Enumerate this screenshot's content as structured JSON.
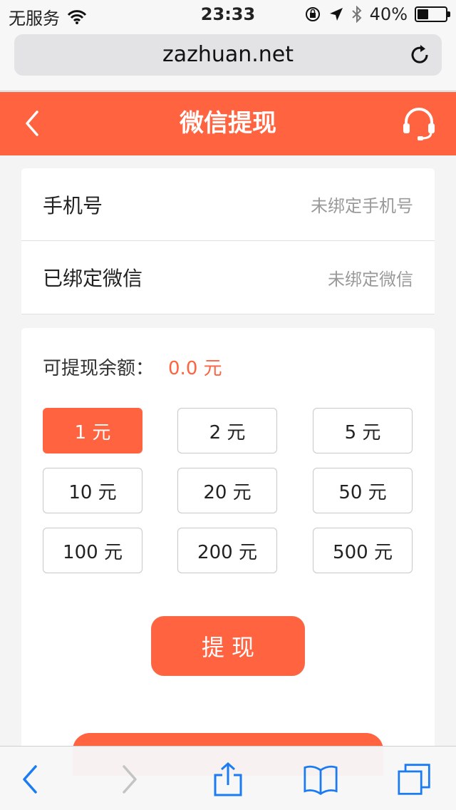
{
  "status_bar": {
    "carrier": "无服务",
    "time": "23:33",
    "battery_percent": "40%",
    "battery_level": 0.4
  },
  "browser": {
    "url": "zazhuan.net"
  },
  "header": {
    "title": "微信提现"
  },
  "info": {
    "phone_label": "手机号",
    "phone_value": "未绑定手机号",
    "wechat_label": "已绑定微信",
    "wechat_value": "未绑定微信"
  },
  "withdraw": {
    "balance_label": "可提现余额：",
    "balance_value": "0.0 元",
    "amounts": [
      "1 元",
      "2 元",
      "5 元",
      "10 元",
      "20 元",
      "50 元",
      "100 元",
      "200 元",
      "500 元"
    ],
    "selected_index": 0,
    "submit_label": "提现"
  },
  "colors": {
    "accent": "#ff6340",
    "browser_link": "#1a7bf2"
  },
  "icons": {
    "header_left": "back-icon",
    "header_right": "headset-icon",
    "toolbar": [
      "back-icon",
      "forward-icon",
      "share-icon",
      "bookmarks-icon",
      "tabs-icon"
    ]
  }
}
